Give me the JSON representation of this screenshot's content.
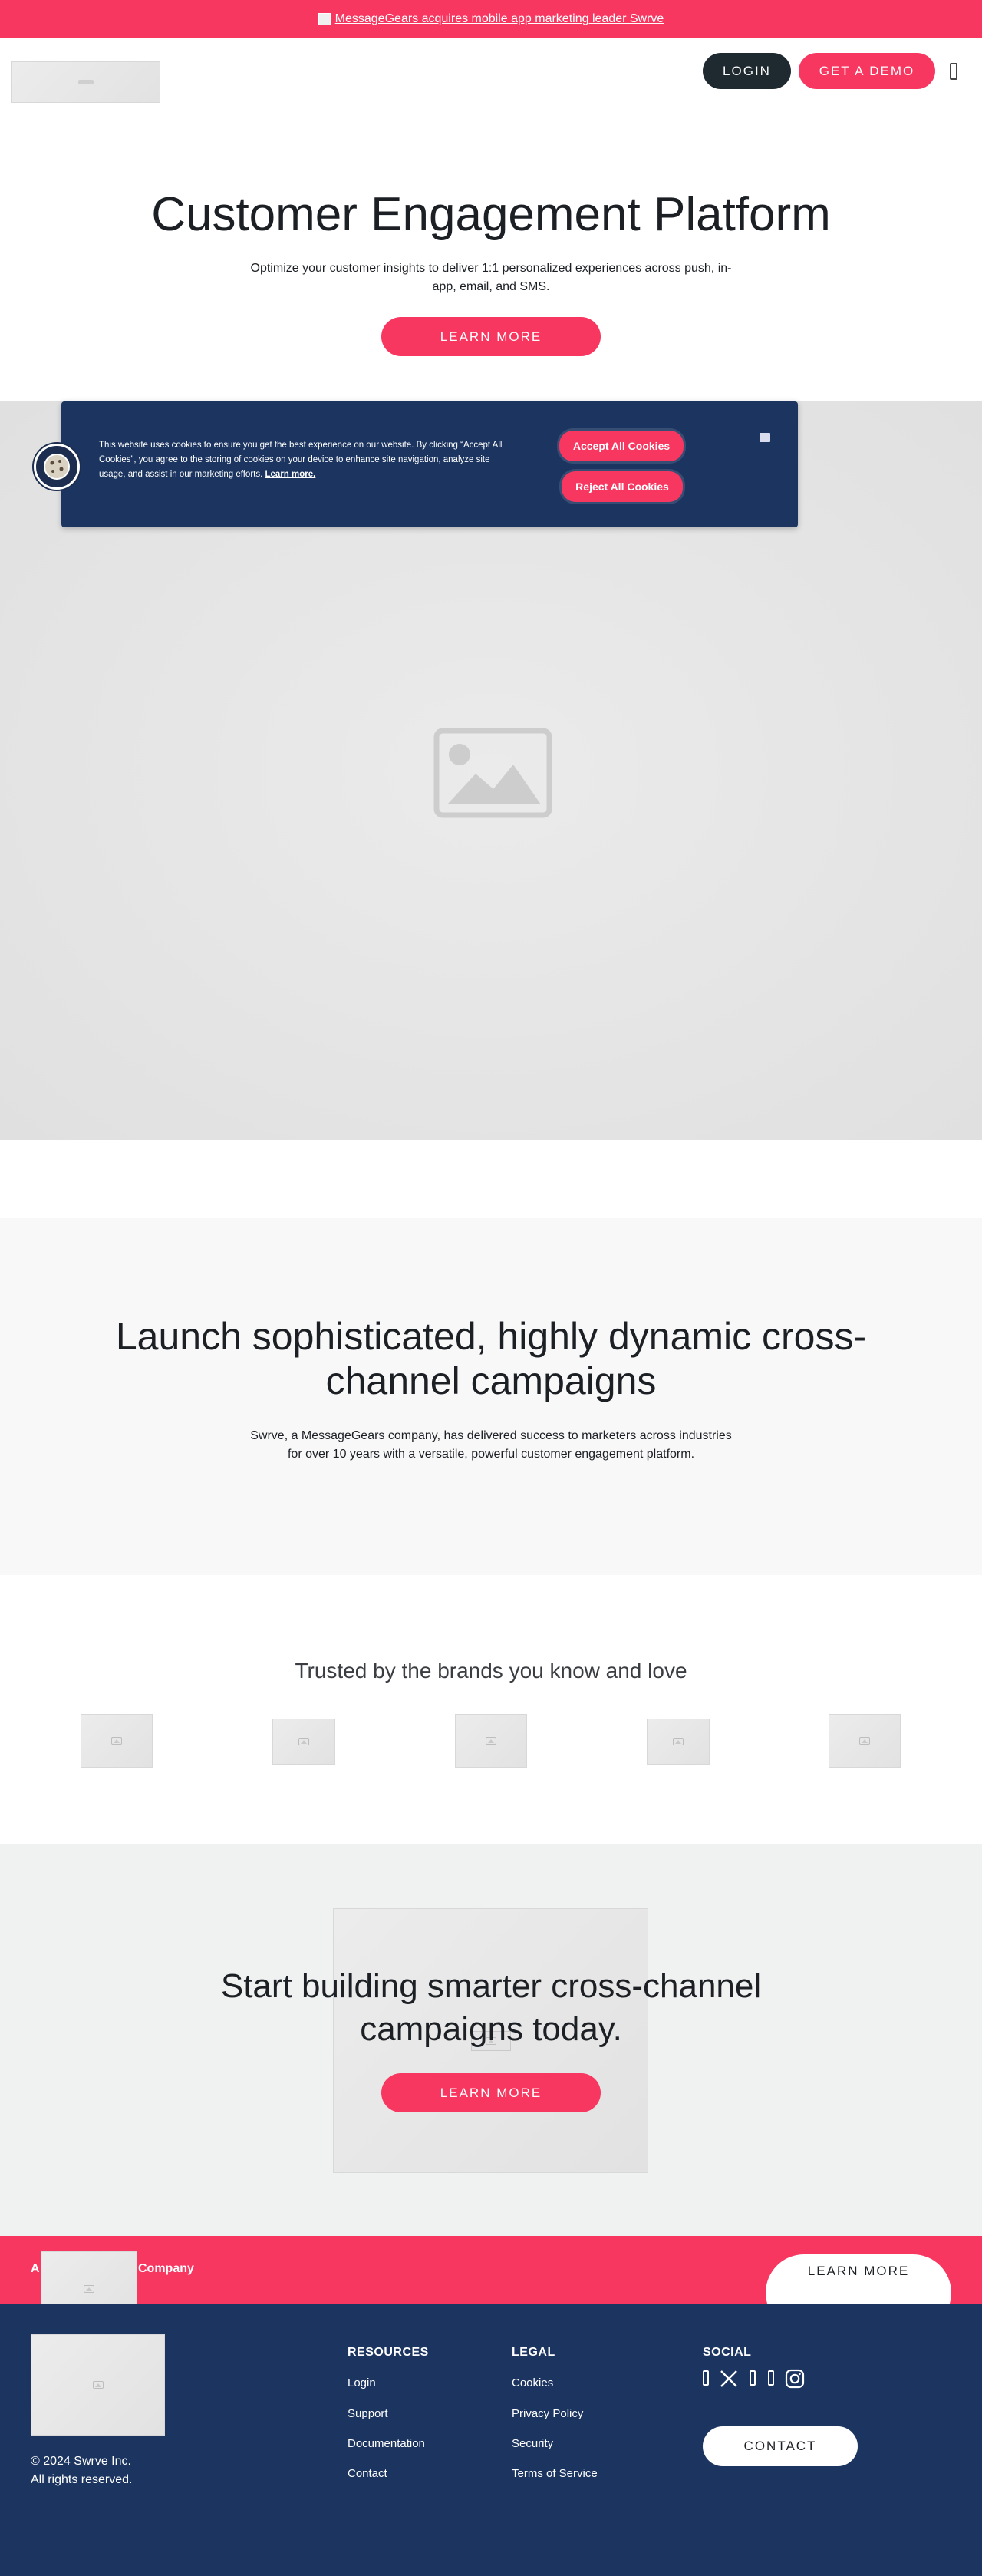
{
  "announcement": {
    "text": "MessageGears acquires mobile app marketing leader Swrve"
  },
  "header": {
    "login_label": "LOGIN",
    "demo_label": "GET A DEMO",
    "menu_icon": "hamburger-icon"
  },
  "hero": {
    "title": "Customer Engagement Platform",
    "subtitle": "Optimize your customer insights to deliver 1:1 personalized experiences across push, in-app, email, and SMS.",
    "button_label": "LEARN MORE"
  },
  "cookie_banner": {
    "text": "This website uses cookies to ensure you get the best experience on our website. By clicking “Accept All Cookies”, you agree to the storing of cookies on your device to enhance site navigation, analyze site usage, and assist in our marketing efforts.",
    "learn_more": "Learn more.",
    "accept_label": "Accept All Cookies",
    "reject_label": "Reject All Cookies"
  },
  "launch": {
    "title": "Launch sophisticated, highly dynamic cross-channel campaigns",
    "subtitle": "Swrve, a MessageGears company, has delivered success to marketers across industries for over 10 years with a versatile, powerful customer engagement platform."
  },
  "trusted": {
    "title": "Trusted by the brands you know and love"
  },
  "cta": {
    "title": "Start building smarter cross-channel campaigns today.",
    "button_label": "LEARN MORE"
  },
  "band": {
    "prefix": "A",
    "suffix": "Company",
    "button_label": "LEARN MORE"
  },
  "footer": {
    "copyright": "© 2024 Swrve Inc.",
    "rights": "All rights reserved.",
    "resources": {
      "heading": "RESOURCES",
      "links": [
        "Login",
        "Support",
        "Documentation",
        "Contact"
      ]
    },
    "legal": {
      "heading": "LEGAL",
      "links": [
        "Cookies",
        "Privacy Policy",
        "Security",
        "Terms of Service"
      ]
    },
    "social": {
      "heading": "SOCIAL",
      "icons": [
        "facebook-icon",
        "x-icon",
        "linkedin-icon",
        "youtube-icon",
        "instagram-icon"
      ]
    },
    "contact_label": "CONTACT"
  },
  "colors": {
    "brand_pink": "#f73760",
    "navy": "#1c3560",
    "dark": "#1f2930"
  }
}
